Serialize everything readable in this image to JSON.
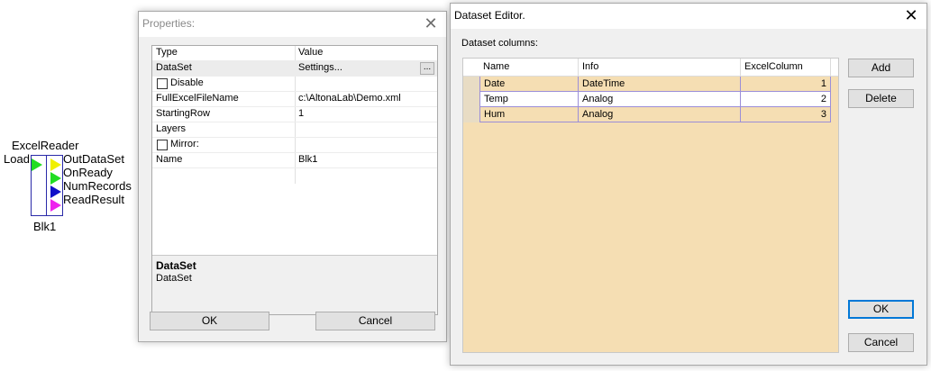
{
  "block": {
    "title": "ExcelReader",
    "input": "Load",
    "name": "Blk1",
    "outputs": [
      "OutDataSet",
      "OnReady",
      "NumRecords",
      "ReadResult"
    ],
    "colors": {
      "input": "#22dd22",
      "outdataset": "#f0f000",
      "onready": "#22dd22",
      "numrecords": "#1010c8",
      "readresult": "#ee22ee",
      "border": "#2a2aa8"
    }
  },
  "properties": {
    "title": "Properties:",
    "close_glyph": "✕",
    "header": {
      "type": "Type",
      "value": "Value"
    },
    "rows": [
      {
        "key": "DataSet",
        "value": "Settings..."
      },
      {
        "key": "Disable",
        "value": ""
      },
      {
        "key": "FullExcelFileName",
        "value": "c:\\AltonaLab\\Demo.xml"
      },
      {
        "key": "StartingRow",
        "value": "1"
      },
      {
        "key": "Layers",
        "value": ""
      },
      {
        "key": "Mirror:",
        "value": ""
      },
      {
        "key": "Name",
        "value": "Blk1"
      }
    ],
    "ellipsis": "...",
    "description": {
      "title": "DataSet",
      "text": "DataSet"
    },
    "ok": "OK",
    "cancel": "Cancel"
  },
  "dataset_editor": {
    "title": "Dataset Editor.",
    "close_glyph": "✕",
    "columns_label": "Dataset columns:",
    "headers": [
      "Name",
      "Info",
      "ExcelColumn"
    ],
    "rows": [
      {
        "name": "Date",
        "info": "DateTime",
        "excel_column": "1"
      },
      {
        "name": "Temp",
        "info": "Analog",
        "excel_column": "2"
      },
      {
        "name": "Hum",
        "info": "Analog",
        "excel_column": "3"
      }
    ],
    "add": "Add",
    "delete": "Delete",
    "ok": "OK",
    "cancel": "Cancel",
    "grid_bg": "#f5deb3"
  }
}
